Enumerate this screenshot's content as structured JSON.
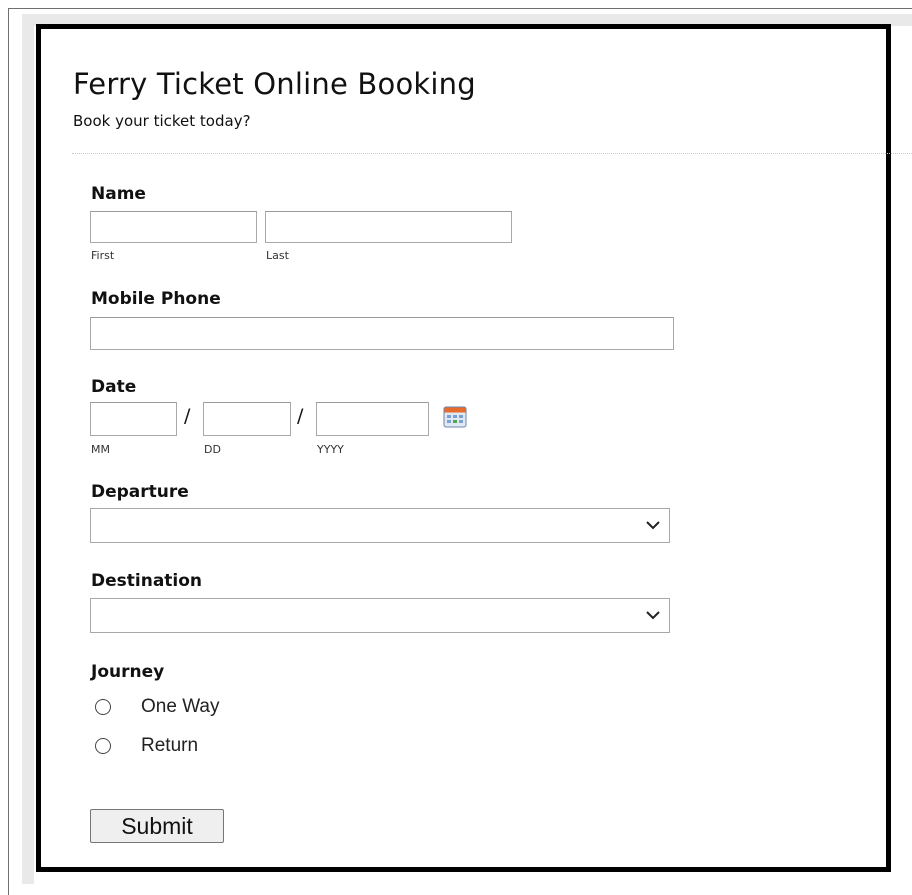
{
  "header": {
    "title": "Ferry Ticket Online Booking",
    "subtitle": "Book your ticket today?"
  },
  "name": {
    "label": "Name",
    "first_value": "",
    "last_value": "",
    "first_sublabel": "First",
    "last_sublabel": "Last"
  },
  "mobile": {
    "label": "Mobile Phone",
    "value": ""
  },
  "date": {
    "label": "Date",
    "separator": "/",
    "mm_value": "",
    "dd_value": "",
    "yyyy_value": "",
    "mm_sublabel": "MM",
    "dd_sublabel": "DD",
    "yyyy_sublabel": "YYYY",
    "icon": "calendar-icon"
  },
  "departure": {
    "label": "Departure",
    "selected": ""
  },
  "destination": {
    "label": "Destination",
    "selected": ""
  },
  "journey": {
    "label": "Journey",
    "options": [
      "One Way",
      "Return"
    ],
    "selected": null
  },
  "submit": {
    "label": "Submit"
  },
  "colors": {
    "frame": "#000000",
    "input_border": "#a9a9a9",
    "button_bg": "#efefef"
  }
}
